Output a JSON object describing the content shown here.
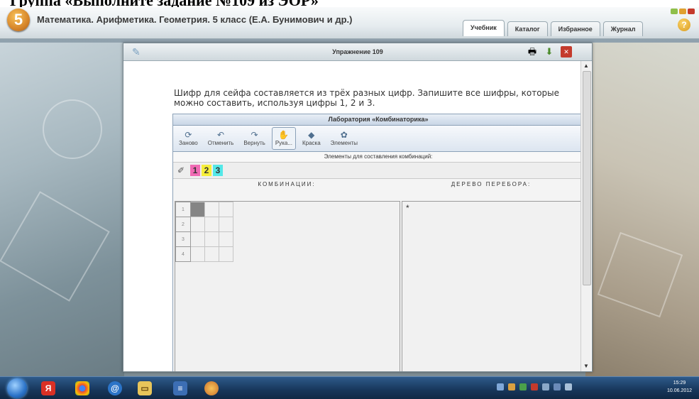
{
  "caption": "Группа «Выполните задание №109 из ЭОР»",
  "app": {
    "logo_number": "5",
    "title": "Математика. Арифметика. Геометрия. 5 класс (Е.А. Бунимович и др.)",
    "tabs": [
      "Учебник",
      "Каталог",
      "Избранное",
      "Журнал"
    ],
    "active_tab": "Учебник",
    "help_label": "?"
  },
  "window": {
    "title": "Упражнение 109",
    "task_text": "Шифр для сейфа составляется из трёх разных цифр. Запишите все шифры, которые можно составить, используя цифры 1, 2 и 3."
  },
  "lab": {
    "title": "Лаборатория «Комбинаторика»",
    "tools": [
      {
        "label": "Заново",
        "icon": "refresh-icon"
      },
      {
        "label": "Отменить",
        "icon": "undo-icon"
      },
      {
        "label": "Вернуть",
        "icon": "redo-icon"
      },
      {
        "label": "Рука...",
        "icon": "hand-icon",
        "selected": true
      },
      {
        "label": "Краска",
        "icon": "paint-icon"
      },
      {
        "label": "Элементы",
        "icon": "elements-icon"
      }
    ],
    "elements_label": "Элементы для составления комбинаций:",
    "digits": [
      {
        "value": "1",
        "color": "#f06bb4"
      },
      {
        "value": "2",
        "color": "#f6ee3a"
      },
      {
        "value": "3",
        "color": "#54e8e8"
      }
    ],
    "combinations_header": "КОМБИНАЦИИ:",
    "tree_header": "ДЕРЕВО ПЕРЕБОРА:",
    "row_numbers": [
      "1",
      "2",
      "3",
      "4"
    ],
    "tree_root": "*"
  },
  "taskbar": {
    "clock_time": "15:29",
    "clock_date": "10.06.2012",
    "apps": [
      "yandex-icon",
      "chrome-icon",
      "mail-icon",
      "folder-icon",
      "word-icon",
      "app-icon"
    ]
  },
  "colors": {
    "accent": "#2a72c8",
    "filled_cell": "#858585"
  }
}
